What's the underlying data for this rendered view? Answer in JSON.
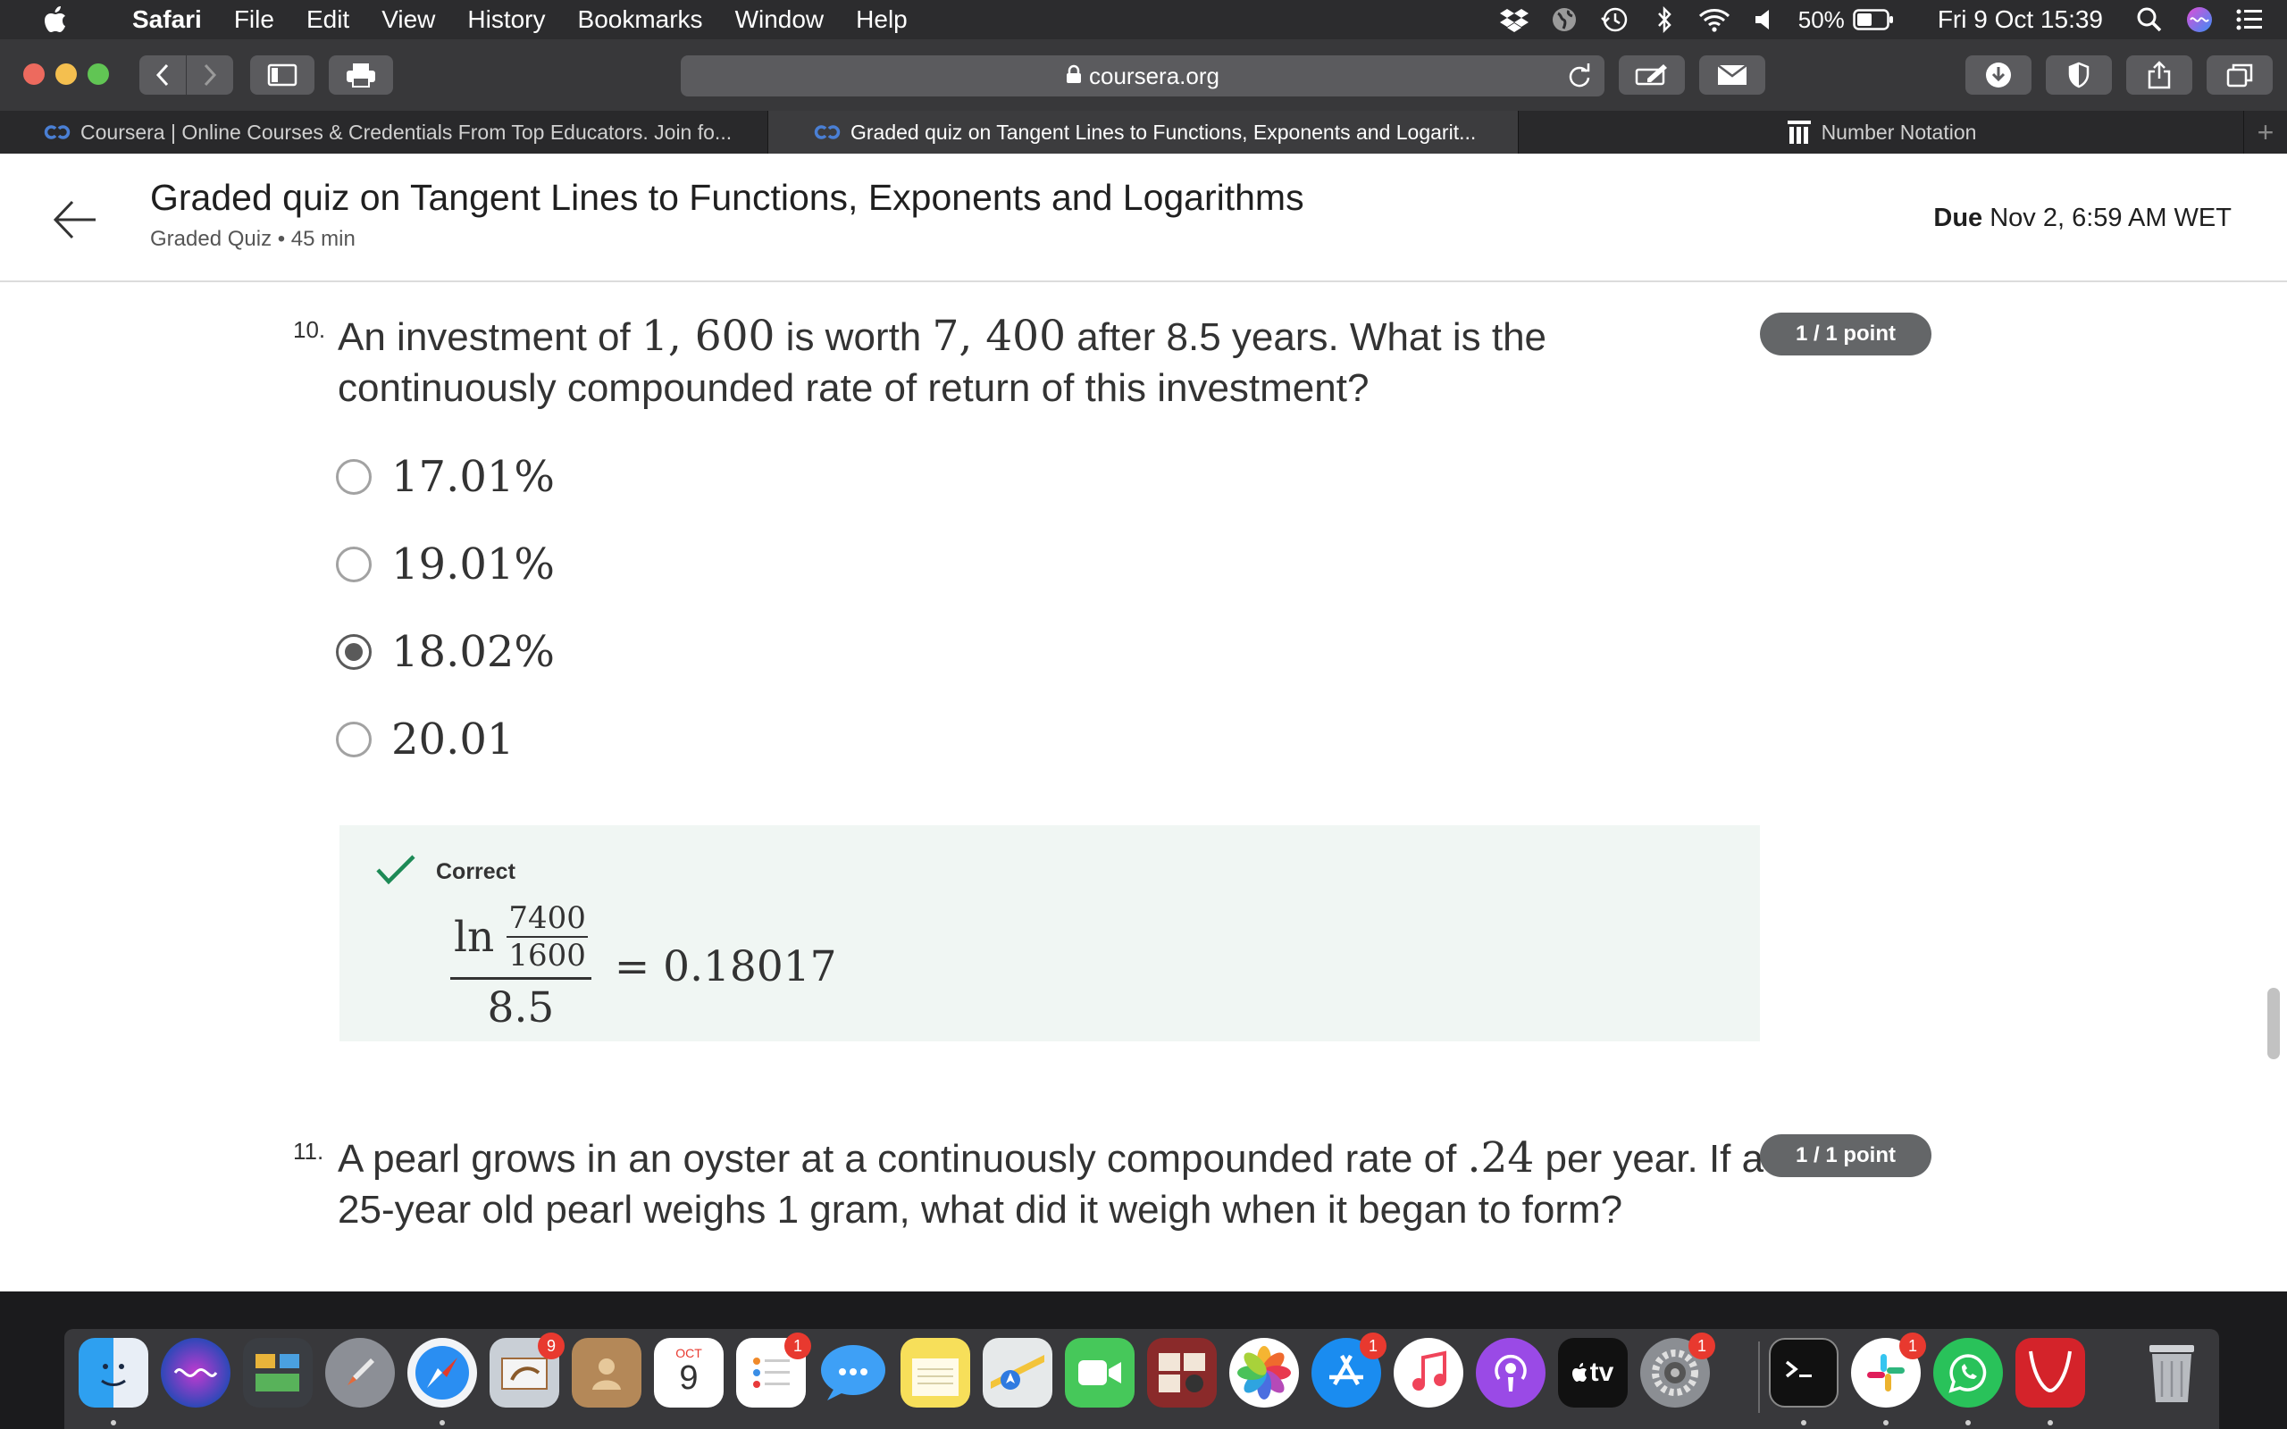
{
  "menubar": {
    "app_name": "Safari",
    "items": [
      "File",
      "Edit",
      "View",
      "History",
      "Bookmarks",
      "Window",
      "Help"
    ],
    "battery": "50%",
    "clock": "Fri 9 Oct  15:39"
  },
  "browser": {
    "url": "coursera.org",
    "tabs": [
      {
        "title": "Coursera | Online Courses & Credentials From Top Educators. Join fo..."
      },
      {
        "title": "Graded quiz on Tangent Lines to Functions, Exponents and Logarit..."
      },
      {
        "title": "Number Notation"
      }
    ],
    "new_tab": "+"
  },
  "quiz": {
    "title": "Graded quiz on Tangent Lines to Functions, Exponents and Logarithms",
    "subtitle": "Graded Quiz • 45 min",
    "due_label": "Due",
    "due_date": "Nov 2, 6:59 AM WET"
  },
  "q10": {
    "number": "10.",
    "text_a": "An investment of ",
    "math_a": "1, 600",
    "text_b": " is worth ",
    "math_b": "7, 400",
    "text_c": " after 8.5 years. What is the continuously compounded rate of return of this investment?",
    "points": "1 / 1 point",
    "options": [
      "17.01%",
      "19.01%",
      "18.02%",
      "20.01"
    ],
    "selected_index": 2,
    "feedback": {
      "label": "Correct",
      "ln": "ln",
      "numerator": "7400",
      "denominator": "1600",
      "divisor": "8.5",
      "result": "= 0.18017"
    }
  },
  "q11": {
    "number": "11.",
    "text_a": "A pearl grows in an oyster at a continuously compounded rate of ",
    "math_a": ".24",
    "text_b": " per year. If a 25-year old pearl weighs 1 gram, what did it weigh when it began to form?",
    "points": "1 / 1 point"
  },
  "dock": {
    "badges": {
      "mail": "9",
      "reminders": "1",
      "appstore": "1",
      "sysprefs": "1",
      "slack": "1"
    },
    "calendar_month": "OCT",
    "calendar_day": "9",
    "tv_label": "tv"
  }
}
